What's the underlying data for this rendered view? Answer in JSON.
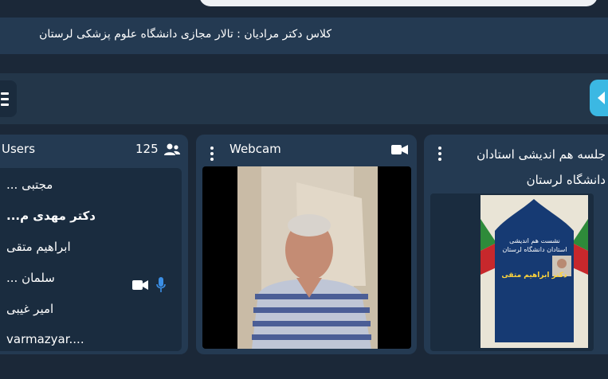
{
  "titlebar": {
    "title": "کلاس دکتر مرادیان : تالار مجازی دانشگاه علوم پزشکی لرستان"
  },
  "users_panel": {
    "label": "Users",
    "count": "125",
    "items": [
      {
        "name": "مجتبی ..."
      },
      {
        "name": "دکتر مهدی م..."
      },
      {
        "name": "ابراهیم متقی"
      },
      {
        "name": "سلمان ..."
      },
      {
        "name": "امیر غیبی"
      },
      {
        "name": "varmazyar...."
      }
    ]
  },
  "webcam_panel": {
    "label": "Webcam"
  },
  "slide_panel": {
    "title": "جلسه هم اندیشی استادان دانشگاه لرستان",
    "poster": {
      "heading": "نشست هم اندیشی استادان دانشگاه لرستان",
      "speaker": "دکتر ابراهیم متقی"
    }
  },
  "colors": {
    "accent": "#3bb8e3",
    "panel": "#243a52",
    "background": "#1b2838",
    "mic": "#3b8fe6"
  }
}
